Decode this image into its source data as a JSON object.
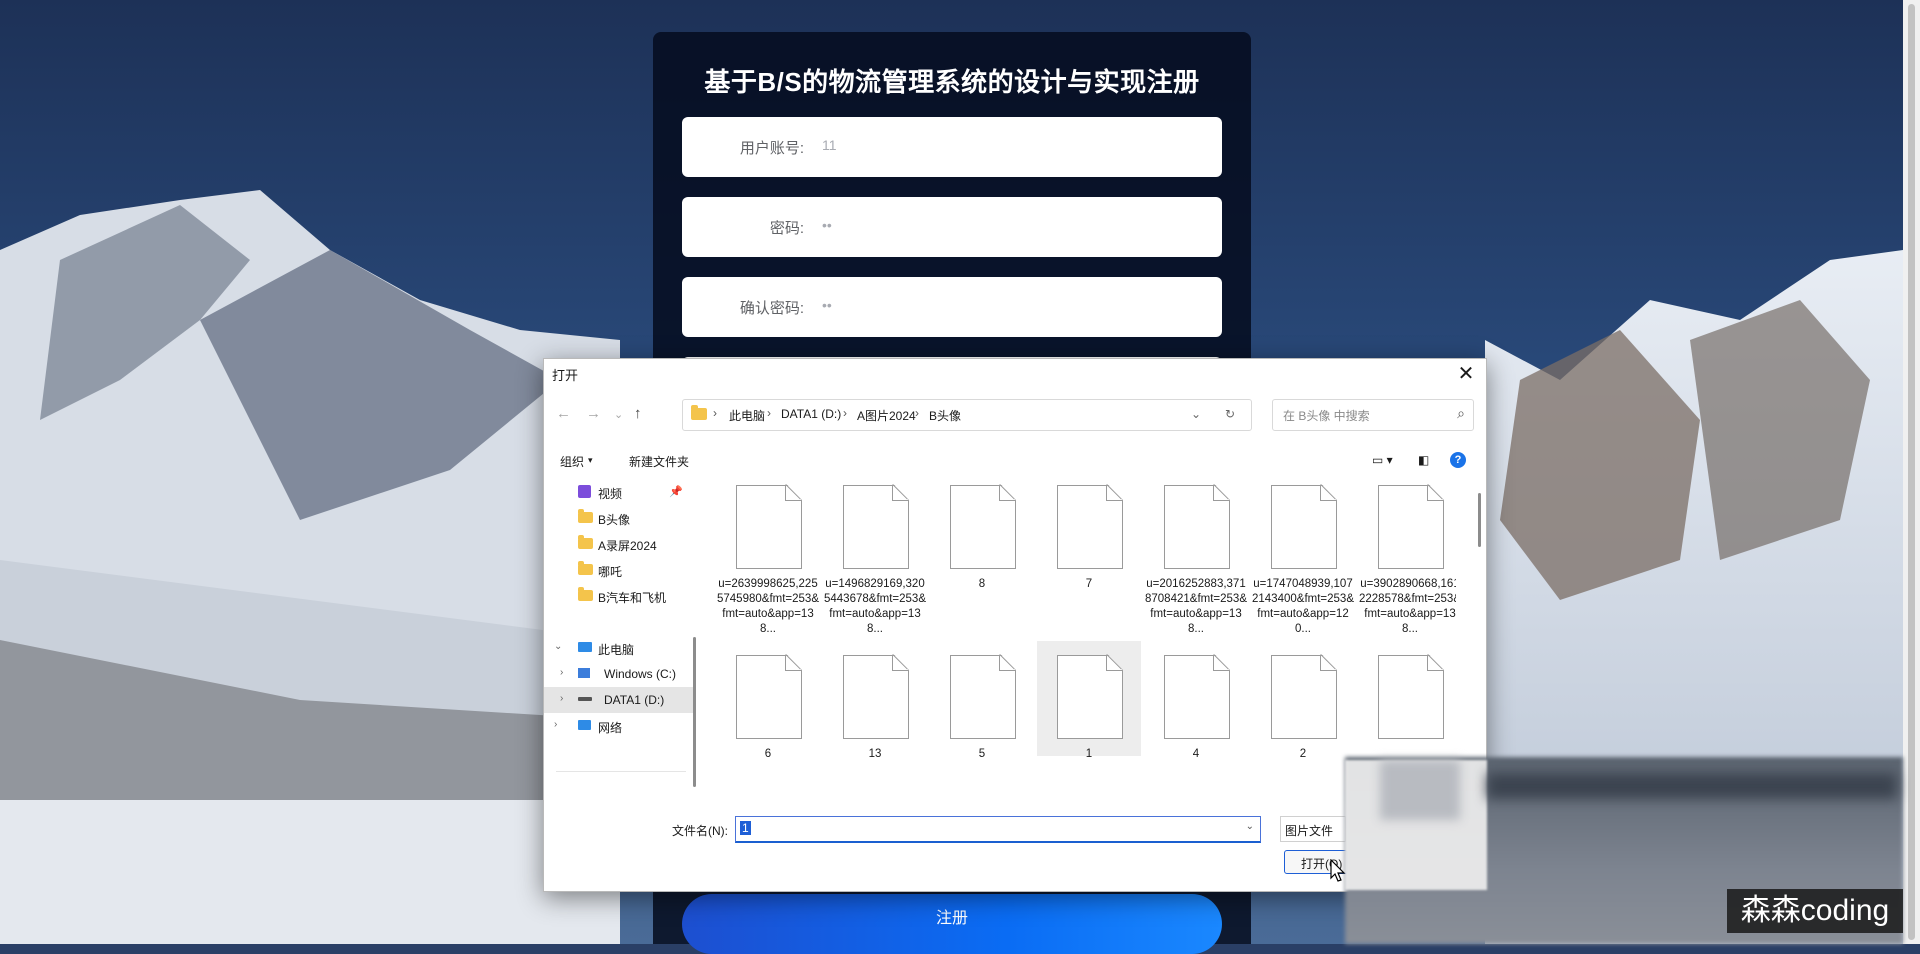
{
  "registration": {
    "title": "基于B/S的物流管理系统的设计与实现注册",
    "fields": [
      {
        "label": "用户账号:",
        "value": "11"
      },
      {
        "label": "密码:",
        "value": "••"
      },
      {
        "label": "确认密码:",
        "value": "••"
      }
    ],
    "submit_label": "注册"
  },
  "dialog": {
    "title": "打开",
    "breadcrumb": [
      "此电脑",
      "DATA1 (D:)",
      "A图片2024",
      "B头像"
    ],
    "search_placeholder": "在 B头像 中搜索",
    "toolbar": {
      "organize": "组织",
      "new_folder": "新建文件夹"
    },
    "nav_items": [
      {
        "label": "视频",
        "icon": "video-icon",
        "pinned": true
      },
      {
        "label": "B头像",
        "icon": "folder-icon"
      },
      {
        "label": "A录屏2024",
        "icon": "folder-icon"
      },
      {
        "label": "哪吒",
        "icon": "folder-icon"
      },
      {
        "label": "B汽车和飞机",
        "icon": "folder-icon"
      },
      {
        "label": "此电脑",
        "icon": "computer-icon"
      },
      {
        "label": "Windows (C:)",
        "icon": "drive-c-icon"
      },
      {
        "label": "DATA1 (D:)",
        "icon": "drive-d-icon",
        "selected": true
      },
      {
        "label": "网络",
        "icon": "network-icon"
      }
    ],
    "files": [
      "u=2639998625,2255745980&fmt=253&fmt=auto&app=138...",
      "u=1496829169,3205443678&fmt=253&fmt=auto&app=138...",
      "8",
      "7",
      "u=2016252883,3718708421&fmt=253&fmt=auto&app=138...",
      "u=1747048939,1072143400&fmt=253&fmt=auto&app=120...",
      "u=3902890668,1612228578&fmt=253&fmt=auto&app=138...",
      "6",
      "13",
      "5",
      "1",
      "4",
      "2",
      ""
    ],
    "selected_file": "1",
    "filename_label": "文件名(N):",
    "filename_value": "1",
    "file_type": "图片文件",
    "open_label": "打开(O)"
  },
  "watermark": "森森coding"
}
